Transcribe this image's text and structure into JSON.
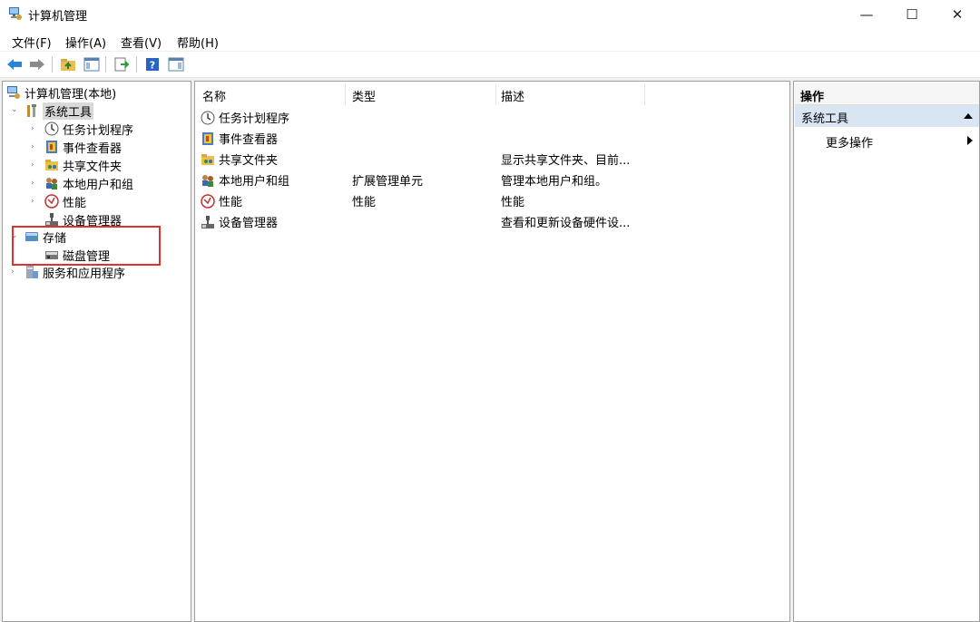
{
  "window": {
    "title": "计算机管理",
    "icon": "computer-management-icon"
  },
  "window_controls": {
    "minimize": "—",
    "maximize": "☐",
    "close": "✕"
  },
  "menu": [
    "文件(F)",
    "操作(A)",
    "查看(V)",
    "帮助(H)"
  ],
  "toolbar_icons": [
    "back-arrow-icon",
    "forward-arrow-icon",
    "up-folder-icon",
    "show-hide-console-tree-icon",
    "export-list-icon",
    "help-icon",
    "show-hide-action-pane-icon"
  ],
  "tree": {
    "root": "计算机管理(本地)",
    "system_tools": "系统工具",
    "items": [
      "任务计划程序",
      "事件查看器",
      "共享文件夹",
      "本地用户和组",
      "性能",
      "设备管理器"
    ],
    "storage": "存储",
    "disk_management": "磁盘管理",
    "services": "服务和应用程序"
  },
  "list": {
    "columns": [
      "名称",
      "类型",
      "描述"
    ],
    "rows": [
      {
        "name": "任务计划程序",
        "type": "",
        "desc": "",
        "icon": "clock-icon"
      },
      {
        "name": "事件查看器",
        "type": "",
        "desc": "",
        "icon": "event-log-icon"
      },
      {
        "name": "共享文件夹",
        "type": "",
        "desc": "显示共享文件夹、目前...",
        "icon": "shared-folder-icon"
      },
      {
        "name": "本地用户和组",
        "type": "扩展管理单元",
        "desc": "管理本地用户和组。",
        "icon": "users-icon"
      },
      {
        "name": "性能",
        "type": "性能",
        "desc": "性能",
        "icon": "performance-icon"
      },
      {
        "name": "设备管理器",
        "type": "",
        "desc": "查看和更新设备硬件设...",
        "icon": "device-manager-icon"
      }
    ]
  },
  "actions": {
    "header": "操作",
    "section": "系统工具",
    "more": "更多操作"
  },
  "colors": {
    "highlight_box": "#e03030",
    "action_section_bg": "#d9e5f2",
    "selection_bg": "#d9d9d9"
  }
}
